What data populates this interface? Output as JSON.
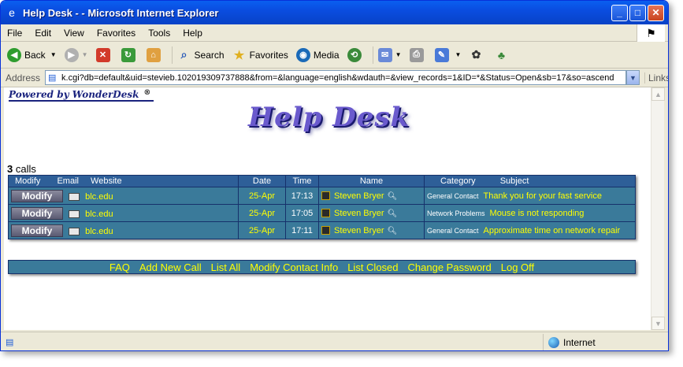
{
  "window": {
    "title": "Help Desk - - Microsoft Internet Explorer"
  },
  "menu": [
    "File",
    "Edit",
    "View",
    "Favorites",
    "Tools",
    "Help"
  ],
  "toolbar": {
    "back": "Back",
    "search": "Search",
    "favorites": "Favorites",
    "media": "Media"
  },
  "address": {
    "label": "Address",
    "url": "k.cgi?db=default&uid=stevieb.102019309737888&from=&language=english&wdauth=&view_records=1&ID=*&Status=Open&sb=17&so=ascend",
    "links": "Links"
  },
  "page": {
    "powered_by": "Powered by WonderDesk",
    "powered_mark": "®",
    "logo": "Help Desk",
    "calls_count": "3",
    "calls_label": " calls",
    "columns": {
      "modify": "Modify",
      "email": "Email",
      "website": "Website",
      "date": "Date",
      "time": "Time",
      "name": "Name",
      "category": "Category",
      "subject": "Subject"
    },
    "rows": [
      {
        "button": "Modify",
        "website": "blc.edu",
        "date": "25-Apr",
        "time": "17:13",
        "name": "Steven Bryer",
        "category": "General Contact",
        "subject": "Thank you for your fast service"
      },
      {
        "button": "Modify",
        "website": "blc.edu",
        "date": "25-Apr",
        "time": "17:05",
        "name": "Steven Bryer",
        "category": "Network Problems",
        "subject": "Mouse is not responding"
      },
      {
        "button": "Modify",
        "website": "blc.edu",
        "date": "25-Apr",
        "time": "17:11",
        "name": "Steven Bryer",
        "category": "General Contact",
        "subject": "Approximate time on network repair"
      }
    ],
    "footer_links": [
      "FAQ",
      "Add New Call",
      "List All",
      "Modify Contact Info",
      "List Closed",
      "Change Password",
      "Log Off"
    ]
  },
  "status": {
    "zone": "Internet"
  },
  "colors": {
    "title_bar": "#0a4de0",
    "table_bg": "#3a7a9a",
    "table_header": "#2e5f98",
    "link_yellow": "#ffff00"
  }
}
